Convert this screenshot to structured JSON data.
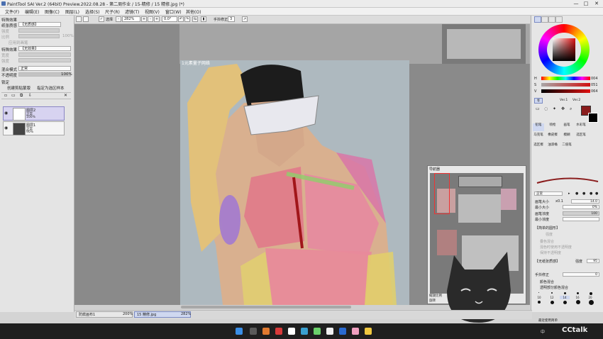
{
  "window": {
    "title": "PaintTool SAI Ver.2 (64bit) Preview.2022.08.28 - 第二周作业 / 15-精修 / 15 精修.jpg (*)",
    "minimize": "—",
    "maximize": "□",
    "close": "✕"
  },
  "menu": [
    "文件(F)",
    "编辑(E)",
    "图像(C)",
    "图层(L)",
    "选择(S)",
    "尺子(R)",
    "滤镜(T)",
    "视图(V)",
    "窗口(W)",
    "其他(O)"
  ],
  "toolbar": {
    "select_label": "选择",
    "zoom": "282%",
    "rotation": "0.0°",
    "stabilizer_label": "手抖修正",
    "stabilizer_value": "3"
  },
  "left_panel": {
    "effects_header": "特殊效果",
    "texture_label": "纸张质感",
    "texture_value": "【无质感】",
    "texture_scale_label": "强度",
    "texture_contrast_label": "比例",
    "texture_contrast_value": "100%",
    "texture_apply_label": "应用到画笔",
    "effect_label": "特殊效果",
    "effect_value": "【无效果】",
    "effect_width_label": "宽度",
    "effect_strength_label": "强度",
    "blend_label": "混合模式",
    "blend_value": "正常",
    "opacity_label": "不透明度",
    "opacity_value": "100%",
    "lock_label": "锁定",
    "clip_label": "创建剪贴蒙版",
    "ref_label": "指定为选区样本",
    "layers": [
      {
        "name": "图层2",
        "mode": "正常",
        "opacity": "100%"
      },
      {
        "name": "图层1",
        "mode": "正常",
        "opacity": "90%"
      }
    ]
  },
  "canvas": {
    "photo_caption": "1元素量子网络"
  },
  "right_panel": {
    "hsv": [
      {
        "label": "H",
        "value": "004"
      },
      {
        "label": "S",
        "value": "051"
      },
      {
        "label": "V",
        "value": "064"
      }
    ],
    "mode_tabs": [
      "等",
      "Ver.1",
      "Ver.2"
    ],
    "tools": [
      "铅笔",
      "喷枪",
      "画笔",
      "水彩笔",
      "马克笔",
      "橡皮擦",
      "模糊",
      "选区笔",
      "选区擦",
      "油漆桶",
      "二值笔",
      "",
      "",
      "",
      "",
      "",
      "",
      "",
      "",
      ""
    ],
    "brush_mode": "正常",
    "brush_size_label": "画笔大小",
    "brush_size_mult": "x0.1",
    "brush_size_value": "14.0",
    "min_size_label": "最小大小",
    "min_size_value": "0%",
    "density_label": "画笔浓度",
    "density_value": "100",
    "min_density_label": "最小浓度",
    "shape_header": "【简单的圆形】",
    "shape_strength": "强度",
    "shape_opts": [
      "叠色混合",
      "混色时使用不透明度",
      "保持不透明度"
    ],
    "texture_header": "【无纸张质感】",
    "texture_value": "强度",
    "texture_num": "95",
    "stabilizer_label": "手抖修正",
    "stabilizer_value": "0",
    "opt1": "颜色混合",
    "opt2": "透明部分颜色混合",
    "sizes": [
      "10",
      "12",
      "14",
      "16",
      "20",
      "25",
      "30",
      "35",
      "40",
      "50"
    ],
    "recent_label": "最近使用简单"
  },
  "navigator": {
    "title": "导航器",
    "zoom_label": "缩放比例",
    "rotate_label": "旋转"
  },
  "statusbar": {
    "tab1_name": "防腐画布1",
    "tab1_zoom": "200%",
    "tab2_name": "15 精修.jpg",
    "tab2_zoom": "282%"
  },
  "taskbar": {
    "time": "中",
    "watermark": "CCtalk"
  },
  "colors": {
    "foreground": "#8a1c1c",
    "background": "#000000",
    "panel": "#e4e4e4",
    "canvas": "#8a8a8a"
  }
}
